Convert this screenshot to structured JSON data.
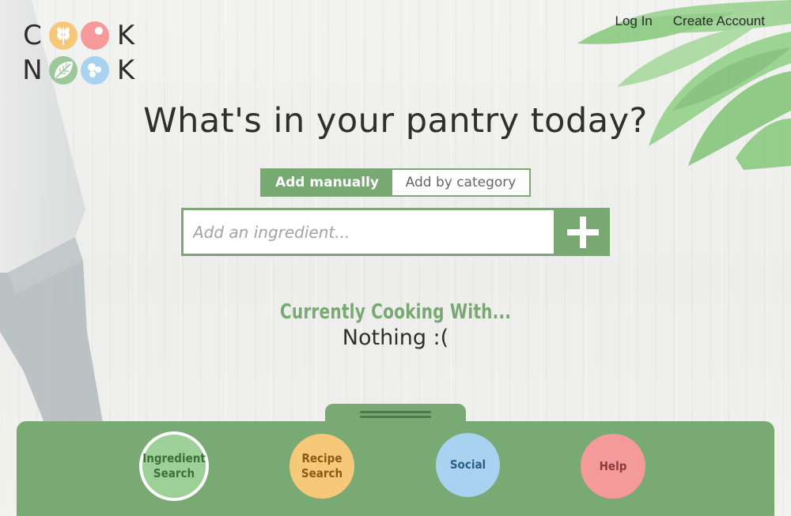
{
  "logo": {
    "row1": {
      "letter_left": "C",
      "letter_right": "K"
    },
    "row2": {
      "letter_left": "N",
      "letter_right": "K"
    },
    "icons": [
      "wheat-icon",
      "tomato-icon",
      "leaf-icon",
      "water-drops-icon"
    ],
    "colors": {
      "yellow": "#f6c97a",
      "pink": "#f49a9a",
      "green": "#9cc89a",
      "blue": "#a9d1f0"
    }
  },
  "topnav": {
    "login": "Log In",
    "create_account": "Create Account"
  },
  "title": "What's in your pantry today?",
  "mode_toggle": {
    "manual": "Add manually",
    "category": "Add by category",
    "selected": "Add manually"
  },
  "ingredient_input": {
    "placeholder": "Add an ingredient...",
    "value": "",
    "add_icon": "plus-icon"
  },
  "cooking": {
    "heading": "Currently Cooking With...",
    "status": "Nothing :("
  },
  "bottom_nav": {
    "ingredient_search": {
      "line1": "Ingredient",
      "line2": "Search"
    },
    "recipe_search": {
      "line1": "Recipe",
      "line2": "Search"
    },
    "social": "Social",
    "help": "Help"
  },
  "colors": {
    "accent": "#78a972",
    "accent_dark": "#4d7a48"
  }
}
